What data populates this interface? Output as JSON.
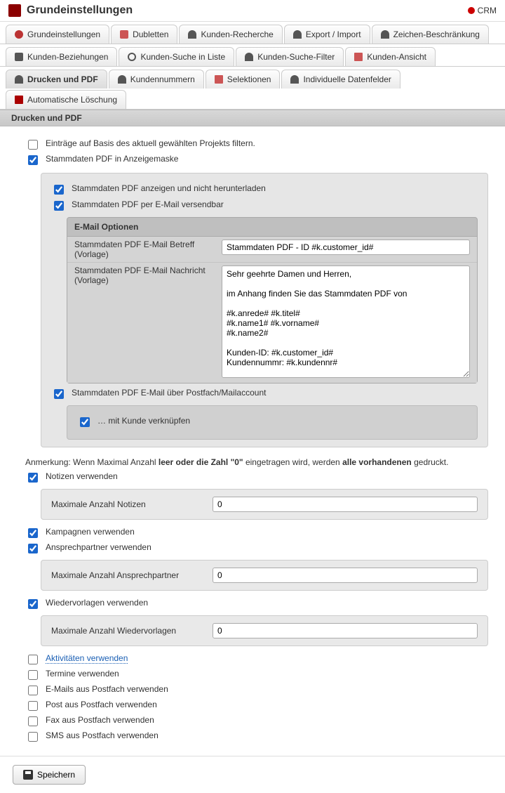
{
  "header": {
    "title": "Grundeinstellungen",
    "crm_label": "CRM"
  },
  "tabs_row1": [
    {
      "label": "Grundeinstellungen",
      "icon": "gear"
    },
    {
      "label": "Dubletten",
      "icon": "dub"
    },
    {
      "label": "Kunden-Recherche",
      "icon": "person"
    },
    {
      "label": "Export / Import",
      "icon": "person"
    },
    {
      "label": "Zeichen-Beschränkung",
      "icon": "person"
    }
  ],
  "tabs_row2": [
    {
      "label": "Kunden-Beziehungen",
      "icon": "link"
    },
    {
      "label": "Kunden-Suche in Liste",
      "icon": "search"
    },
    {
      "label": "Kunden-Suche-Filter",
      "icon": "person"
    },
    {
      "label": "Kunden-Ansicht",
      "icon": "doc"
    }
  ],
  "tabs_row3": [
    {
      "label": "Drucken und PDF",
      "icon": "person",
      "active": true
    },
    {
      "label": "Kundennummern",
      "icon": "person"
    },
    {
      "label": "Selektionen",
      "icon": "doc"
    },
    {
      "label": "Individuelle Datenfelder",
      "icon": "person"
    },
    {
      "label": "Automatische Löschung",
      "icon": "trash"
    }
  ],
  "section_title": "Drucken und PDF",
  "checks": {
    "filter_project": {
      "label": "Einträge auf Basis des aktuell gewählten Projekts filtern.",
      "checked": false
    },
    "stamm_anzeige": {
      "label": "Stammdaten PDF in Anzeigemaske",
      "checked": true
    },
    "stamm_show_not_dl": {
      "label": "Stammdaten PDF anzeigen und nicht herunterladen",
      "checked": true
    },
    "stamm_email_send": {
      "label": "Stammdaten PDF per E-Mail versendbar",
      "checked": true
    },
    "stamm_email_mailbox": {
      "label": "Stammdaten PDF E-Mail über Postfach/Mailaccount",
      "checked": true
    },
    "link_customer": {
      "label": "… mit Kunde verknüpfen",
      "checked": true
    },
    "notizen": {
      "label": "Notizen verwenden",
      "checked": true
    },
    "kampagnen": {
      "label": "Kampagnen verwenden",
      "checked": true
    },
    "ansprechpartner": {
      "label": "Ansprechpartner verwenden",
      "checked": true
    },
    "wiedervorlagen": {
      "label": "Wiedervorlagen verwenden",
      "checked": true
    },
    "aktivitaeten": {
      "label": "Aktivitäten verwenden",
      "checked": false,
      "link": true
    },
    "termine": {
      "label": "Termine verwenden",
      "checked": false
    },
    "emails_postfach": {
      "label": "E-Mails aus Postfach verwenden",
      "checked": false
    },
    "post_postfach": {
      "label": "Post aus Postfach verwenden",
      "checked": false
    },
    "fax_postfach": {
      "label": "Fax aus Postfach verwenden",
      "checked": false
    },
    "sms_postfach": {
      "label": "SMS aus Postfach verwenden",
      "checked": false
    }
  },
  "email": {
    "box_title": "E-Mail Optionen",
    "subject_label": "Stammdaten PDF E-Mail Betreff (Vorlage)",
    "subject_value": "Stammdaten PDF - ID #k.customer_id#",
    "message_label": "Stammdaten PDF E-Mail Nachricht (Vorlage)",
    "message_value": "Sehr geehrte Damen und Herren,\n\nim Anhang finden Sie das Stammdaten PDF von\n\n#k.anrede# #k.titel#\n#k.name1# #k.vorname#\n#k.name2#\n\nKunden-ID: #k.customer_id#\nKundennummr: #k.kundennr#\n\nBitte behandeln Sie dieses Dokument vertraulich.\n\nMit freundlichen Grüßen,\n#abs.name#"
  },
  "note_text": {
    "prefix": "Anmerkung: Wenn Maximal Anzahl ",
    "bold1": "leer oder die Zahl \"0\"",
    "mid": " eingetragen wird, werden ",
    "bold2": "alle vorhandenen",
    "suffix": " gedruckt."
  },
  "max": {
    "notizen": {
      "label": "Maximale Anzahl Notizen",
      "value": "0"
    },
    "ansprechpartner": {
      "label": "Maximale Anzahl Ansprechpartner",
      "value": "0"
    },
    "wiedervorlagen": {
      "label": "Maximale Anzahl Wiedervorlagen",
      "value": "0"
    }
  },
  "footer": {
    "save_label": "Speichern"
  }
}
